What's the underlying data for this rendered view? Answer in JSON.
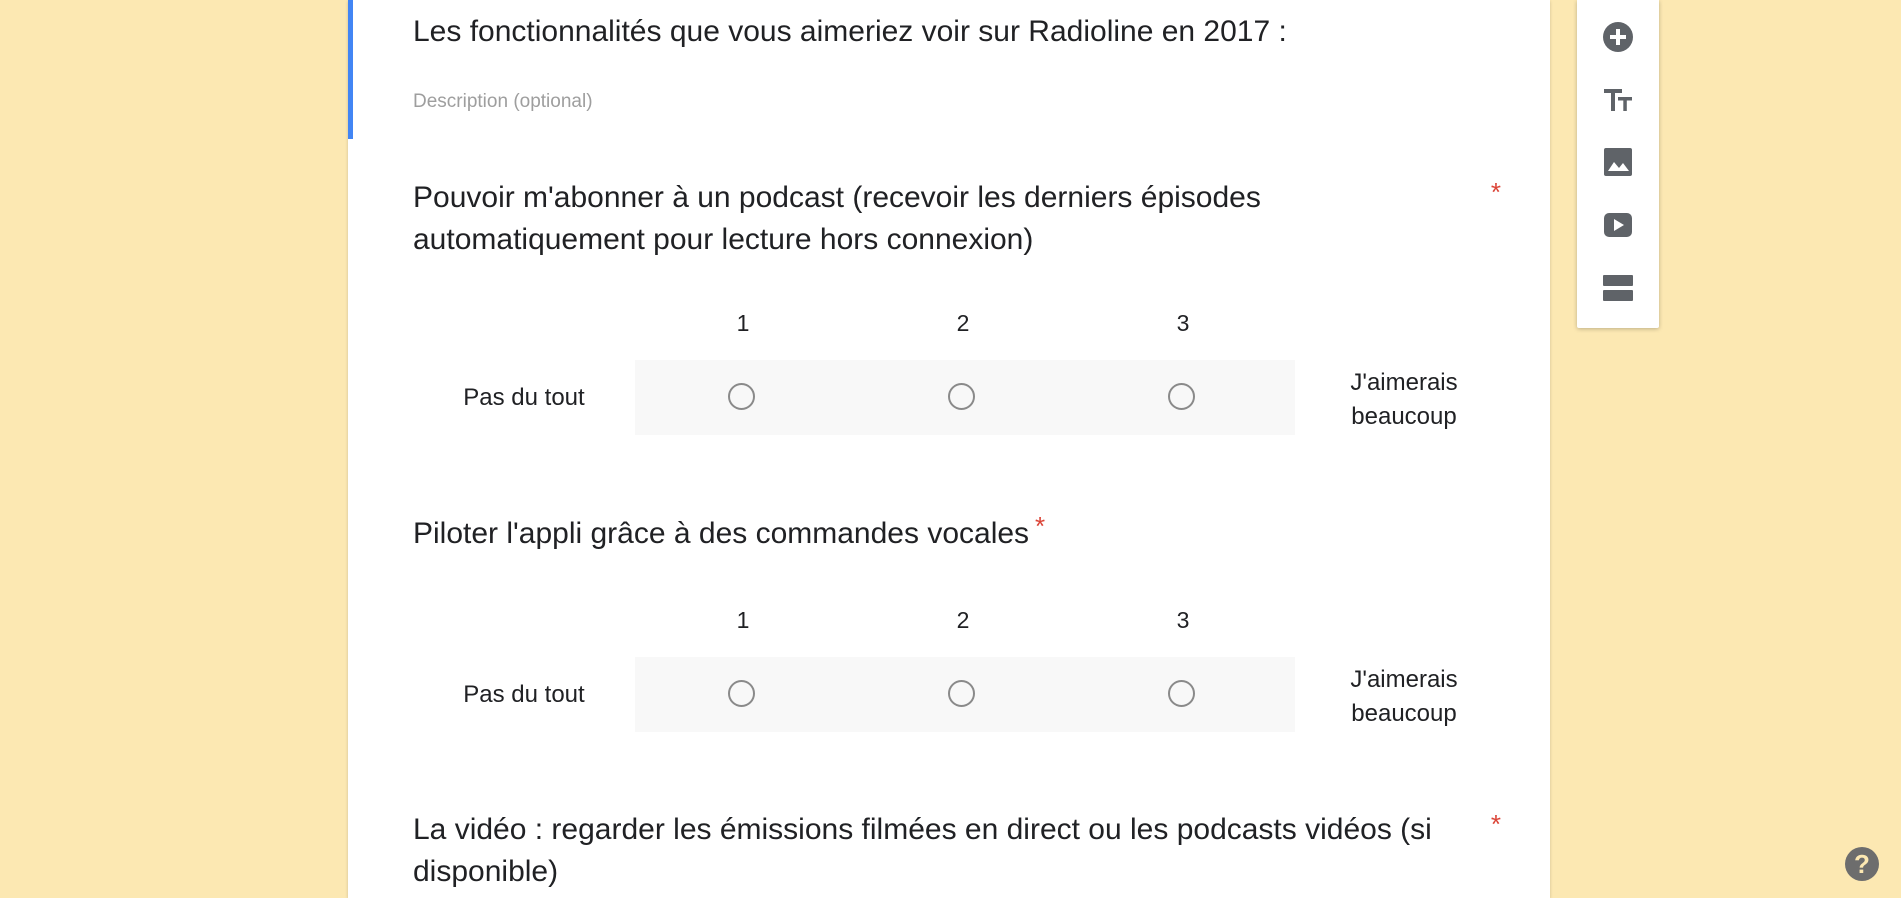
{
  "section": {
    "title": "Les fonctionnalités que vous aimeriez voir sur Radioline en 2017 :",
    "description_placeholder": "Description (optional)",
    "accent_color": "#4285f4"
  },
  "questions": [
    {
      "title": "Pouvoir m'abonner à un podcast (recevoir les derniers épisodes automatiquement pour lecture hors connexion)",
      "required_mark": "*",
      "scale_labels": [
        "1",
        "2",
        "3"
      ],
      "low_label": "Pas du tout",
      "high_label": "J'aimerais beaucoup"
    },
    {
      "title": "Piloter l'appli grâce à des commandes vocales",
      "required_mark": "*",
      "scale_labels": [
        "1",
        "2",
        "3"
      ],
      "low_label": "Pas du tout",
      "high_label": "J'aimerais beaucoup"
    },
    {
      "title": "La vidéo : regarder les émissions filmées en direct ou les podcasts vidéos (si disponible)",
      "required_mark": "*"
    }
  ],
  "toolbar": {
    "items": [
      {
        "icon": "add-question-icon"
      },
      {
        "icon": "title-text-icon"
      },
      {
        "icon": "image-icon"
      },
      {
        "icon": "video-icon"
      },
      {
        "icon": "section-icon"
      }
    ]
  },
  "help": {
    "label": "?"
  },
  "colors": {
    "background": "#fce8b2",
    "required": "#db4437",
    "icon": "#5f6368"
  }
}
